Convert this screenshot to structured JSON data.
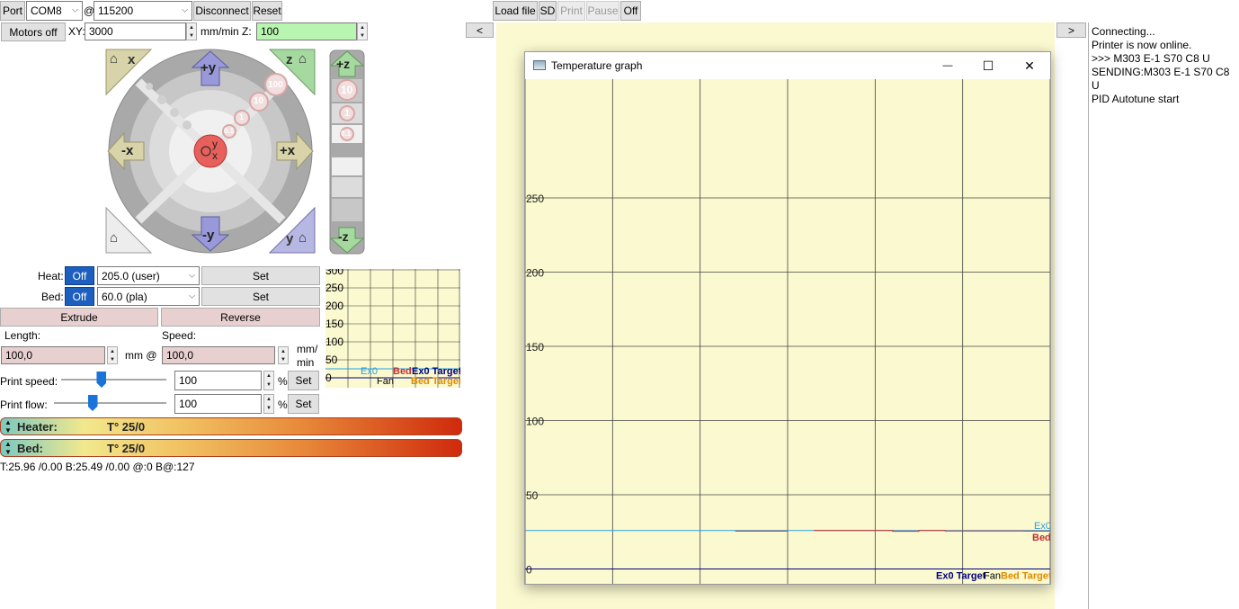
{
  "toolbar": {
    "port_label": "Port",
    "port_value": "COM8",
    "at_symbol": "@",
    "baud_value": "115200",
    "disconnect_label": "Disconnect",
    "reset_label": "Reset",
    "load_file_label": "Load file",
    "sd_label": "SD",
    "print_label": "Print",
    "pause_label": "Pause",
    "off_label": "Off"
  },
  "motion": {
    "motors_off_label": "Motors off",
    "xy_label": "XY:",
    "xy_value": "3000",
    "units_label": "mm/min Z:",
    "z_value": "100"
  },
  "jog": {
    "home_x": "x",
    "home_z": "z",
    "home_y": "y",
    "plus_y": "+y",
    "minus_y": "-y",
    "plus_x": "+x",
    "minus_x": "-x",
    "center_y": "y",
    "center_x": "x",
    "step_100": "100",
    "step_10": "10",
    "step_1": "1",
    "step_01": "0.1",
    "plus_z": "+z",
    "minus_z": "-z",
    "z_step_10": "10",
    "z_step_1": "1",
    "z_step_01": "0.1"
  },
  "temps": {
    "heat_label": "Heat:",
    "heat_off": "Off",
    "heat_value": "205.0 (user)",
    "heat_set": "Set",
    "bed_label": "Bed:",
    "bed_off": "Off",
    "bed_value": "60.0 (pla)",
    "bed_set": "Set"
  },
  "extrude": {
    "extrude_label": "Extrude",
    "reverse_label": "Reverse",
    "length_label": "Length:",
    "speed_label": "Speed:",
    "length_value": "100,0",
    "mm_at": "mm @",
    "speed_value": "100,0",
    "speed_unit_1": "mm/",
    "speed_unit_2": "min"
  },
  "print_speed": {
    "label": "Print speed:",
    "value": "100",
    "pct": "%",
    "set": "Set",
    "level": 0.38
  },
  "print_flow": {
    "label": "Print flow:",
    "value": "100",
    "pct": "%",
    "set": "Set",
    "level": 0.34
  },
  "gauges": {
    "heater_label": "Heater:",
    "heater_temp": "T° 25/0",
    "bed_label": "Bed:",
    "bed_temp": "T° 25/0"
  },
  "status_line": "T:25.96 /0.00 B:25.49 /0.00 @:0 B@:127",
  "mini_graph": {
    "ticks": [
      "300",
      "250",
      "200",
      "150",
      "100",
      "50",
      "0"
    ],
    "legend_ex0": "Ex0",
    "legend_bed": "Bed",
    "legend_ex0_target": "Ex0 Target",
    "legend_fan": "Fan",
    "legend_bed_target": "Bed Target"
  },
  "nav": {
    "left_arrow": "<",
    "right_arrow": ">"
  },
  "console": {
    "lines": [
      "Connecting...",
      "Printer is now online.",
      ">>> M303 E-1 S70 C8 U",
      "SENDING:M303 E-1 S70 C8 U",
      "PID Autotune start"
    ]
  },
  "temp_window": {
    "title": "Temperature graph",
    "minimize": "—",
    "maximize": "☐",
    "close": "✕"
  },
  "chart_data": {
    "type": "line",
    "title": "",
    "xlabel": "",
    "ylabel": "",
    "ylim": [
      -10,
      330
    ],
    "yticks": [
      0,
      50,
      100,
      150,
      200,
      250
    ],
    "grid": true,
    "legend_placement": "right",
    "series": [
      {
        "name": "Ex0",
        "color": "#2aa0e0",
        "values": [
          25.9,
          25.9,
          25.9,
          25.9,
          25.9,
          25.9,
          25.9,
          25.9,
          25.9,
          25.9,
          25.9,
          25.9,
          25.9,
          25.9,
          25.9,
          25.9,
          25.9,
          25.9,
          25.9,
          25.9
        ]
      },
      {
        "name": "Bed",
        "color": "#c03030",
        "values": [
          null,
          null,
          null,
          null,
          null,
          null,
          null,
          null,
          25.5,
          25.5,
          null,
          26.0,
          26.0,
          26.0,
          25.4,
          26.0,
          25.6,
          25.6,
          25.6,
          25.5
        ]
      },
      {
        "name": "Ex0 Target",
        "color": "#000080",
        "values": [
          0,
          0,
          0,
          0,
          0,
          0,
          0,
          0,
          0,
          0,
          0,
          0,
          0,
          0,
          0,
          0,
          0,
          0,
          0,
          0
        ]
      },
      {
        "name": "Fan",
        "color": "#000000",
        "values": []
      },
      {
        "name": "Bed Target",
        "color": "#e08a00",
        "values": []
      }
    ]
  }
}
